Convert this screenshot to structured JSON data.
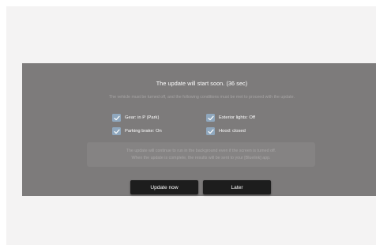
{
  "dialog": {
    "title": "The update will start soon. (36 sec)",
    "subtitle": "The vehicle must be turned off, and the following conditions must be met to proceed with the update.",
    "conditions": [
      {
        "label": "Gear: in P (Park)",
        "checked": true
      },
      {
        "label": "Exterior lights: Off",
        "checked": true
      },
      {
        "label": "Parking brake: On",
        "checked": true
      },
      {
        "label": "Hood: closed",
        "checked": true
      }
    ],
    "notice_line1": "The update will continue to run in the background even if the screen is turned off.",
    "notice_line2": "When the update is complete, the results will be sent to your [Bluelink] app.",
    "update_now_label": "Update now",
    "later_label": "Later"
  },
  "colors": {
    "overlay": "#7d7b7b",
    "checkbox": "#8fa7bd",
    "button": "#1d1d1d",
    "page": "#f4f3f3"
  }
}
